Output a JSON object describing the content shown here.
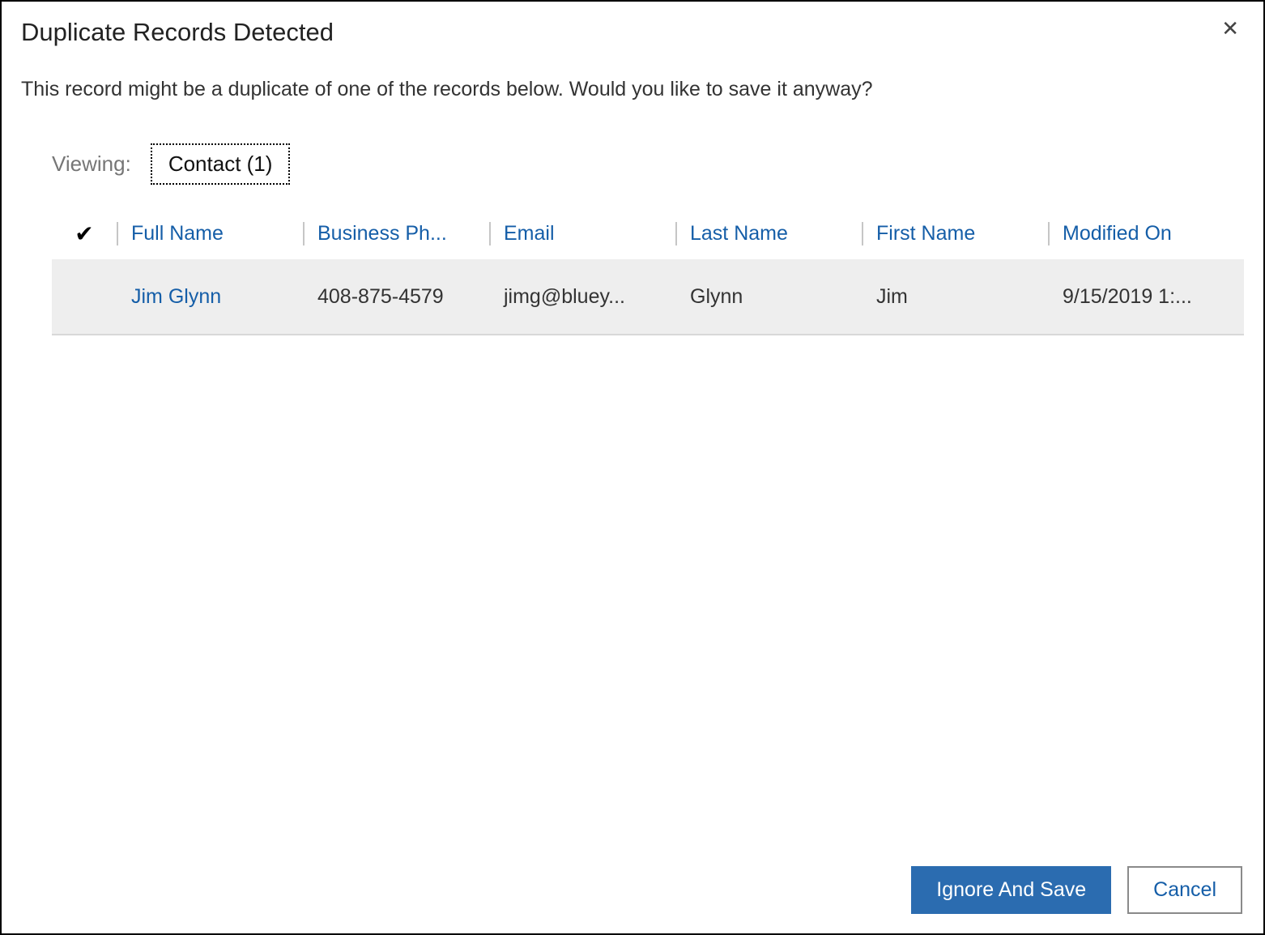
{
  "dialog": {
    "title": "Duplicate Records Detected",
    "message": "This record might be a duplicate of one of the records below. Would you like to save it anyway?"
  },
  "viewing": {
    "label": "Viewing:",
    "tab": "Contact (1)"
  },
  "grid": {
    "columns": {
      "full_name": "Full Name",
      "business_phone": "Business Ph...",
      "email": "Email",
      "last_name": "Last Name",
      "first_name": "First Name",
      "modified_on": "Modified On"
    },
    "rows": [
      {
        "full_name": "Jim Glynn",
        "business_phone": "408-875-4579",
        "email": "jimg@bluey...",
        "last_name": "Glynn",
        "first_name": "Jim",
        "modified_on": "9/15/2019 1:..."
      }
    ]
  },
  "footer": {
    "ignore_save": "Ignore And Save",
    "cancel": "Cancel"
  }
}
